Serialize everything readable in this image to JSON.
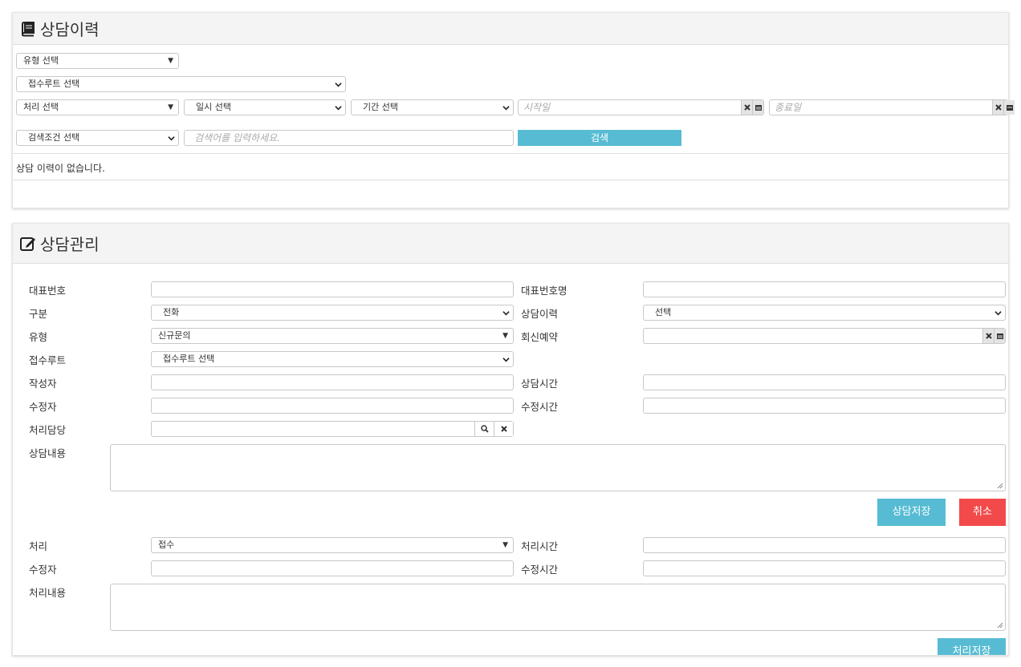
{
  "history": {
    "title": "상담이력",
    "filters": {
      "type_select": "유형 선택",
      "route_select": "접수루트 선택",
      "process_select": "처리 선택",
      "datetime_select": "일시 선택",
      "period_select": "기간 선택",
      "start_placeholder": "시작일",
      "end_placeholder": "종료일",
      "search_condition": "검색조건 선택",
      "search_placeholder": "검색어를 입력하세요.",
      "search_button": "검색"
    },
    "empty_message": "상담 이력이 없습니다."
  },
  "manage": {
    "title": "상담관리",
    "labels": {
      "rep_number": "대표번호",
      "rep_number_name": "대표번호명",
      "category": "구분",
      "history": "상담이력",
      "type": "유형",
      "callback": "회신예약",
      "route": "접수루트",
      "author": "작성자",
      "consult_time": "상담시간",
      "editor": "수정자",
      "edit_time": "수정시간",
      "handler": "처리담당",
      "content": "상담내용"
    },
    "values": {
      "category": "전화",
      "history": "선택",
      "type": "신규문의",
      "route": "접수루트 선택"
    },
    "buttons": {
      "save": "상담저장",
      "cancel": "취소"
    },
    "process": {
      "labels": {
        "process": "처리",
        "process_time": "처리시간",
        "editor": "수정자",
        "edit_time": "수정시간",
        "content": "처리내용"
      },
      "values": {
        "process": "접수"
      },
      "save_button": "처리저장"
    }
  }
}
